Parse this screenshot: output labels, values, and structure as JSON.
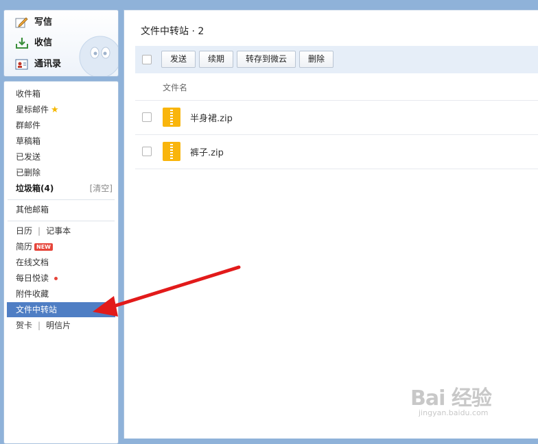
{
  "compose": {
    "write": "写信",
    "inbox_action": "收信",
    "contacts": "通讯录"
  },
  "nav": {
    "inbox": "收件箱",
    "starred": "星标邮件",
    "group": "群邮件",
    "drafts": "草稿箱",
    "sent": "已发送",
    "deleted": "已删除",
    "spam": "垃圾箱(4)",
    "spam_clear": "[清空]",
    "other_mailbox": "其他邮箱",
    "calendar": "日历",
    "notes": "记事本",
    "resume": "简历",
    "new_badge": "NEW",
    "online_docs": "在线文档",
    "daily_read": "每日悦读",
    "attachments": "附件收藏",
    "file_transfer": "文件中转站",
    "card": "贺卡",
    "postcard": "明信片",
    "separator": "|"
  },
  "main": {
    "title": "文件中转站 · 2",
    "toolbar": {
      "send": "发送",
      "renew": "续期",
      "save_to_cloud": "转存到微云",
      "delete": "删除"
    },
    "column_header": "文件名",
    "files": [
      {
        "name": "半身裙.zip"
      },
      {
        "name": "裤子.zip"
      }
    ]
  },
  "watermark": {
    "logo": "Bai 经验",
    "url": "jingyan.baidu.com"
  },
  "colors": {
    "frame": "#8fb2d9",
    "active_nav": "#4f7ec4",
    "toolbar_bg": "#e6eef8",
    "zip_icon": "#f9b50c",
    "arrow": "#e21a1a",
    "badge": "#e6453a"
  }
}
